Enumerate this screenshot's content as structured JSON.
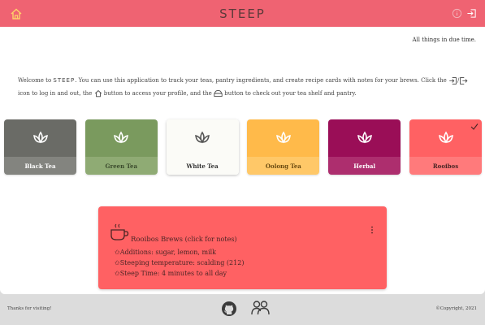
{
  "header": {
    "brand": "STEEP",
    "icons": [
      "home-icon",
      "info-icon",
      "login-icon"
    ]
  },
  "main": {
    "tagline": "All things in due time.",
    "welcome": {
      "part1": "Welcome to ",
      "brand": "STEEP",
      "part2": ". You can use this application to track your teas, pantry ingredients, and create recipe cards with notes for your brews. Click the ",
      "part3": " icon to log in and out, the ",
      "part4": " button to access your profile, and the ",
      "part5": " button to check out your tea shelf and pantry."
    },
    "teas": [
      {
        "label": "Black Tea",
        "top": "#6a6b66",
        "bottom": "#83847f",
        "icon": "#ffffff",
        "text": "#ffffff",
        "selected": false
      },
      {
        "label": "Green Tea",
        "top": "#7a9a5e",
        "bottom": "#8fab74",
        "icon": "#ffffff",
        "text": "#3a4a2c",
        "selected": false
      },
      {
        "label": "White Tea",
        "top": "#fbfbf7",
        "bottom": "#fbfbf7",
        "icon": "#555555",
        "text": "#333333",
        "selected": false
      },
      {
        "label": "Oolong Tea",
        "top": "#ffba4a",
        "bottom": "#ffc868",
        "icon": "#ffffff",
        "text": "#6a4a10",
        "selected": false
      },
      {
        "label": "Herbal",
        "top": "#9a0e57",
        "bottom": "#ad2e6e",
        "icon": "#ffffff",
        "text": "#ffffff",
        "selected": false
      },
      {
        "label": "Rooibos",
        "top": "#ff6163",
        "bottom": "#ff7a7b",
        "icon": "#ffffff",
        "text": "#4a2525",
        "selected": true
      }
    ],
    "recipe": {
      "icon": "tea-cup-icon",
      "title": "Rooibos Brews",
      "subtitle": "(click for notes)",
      "lines": [
        "Additions: sugar, lemon, milk",
        "Steeping temperature: scalding (212)",
        "Steep Time: 4 minutes to all day"
      ]
    }
  },
  "footer": {
    "thanks": "Thanks for visiting!",
    "copyright": "©Copyright, 2021",
    "icons": [
      "github-icon",
      "team-icon"
    ]
  },
  "colors": {
    "header": "#ef6372",
    "recipe": "#ff6163",
    "background": "#dcdcdc"
  }
}
